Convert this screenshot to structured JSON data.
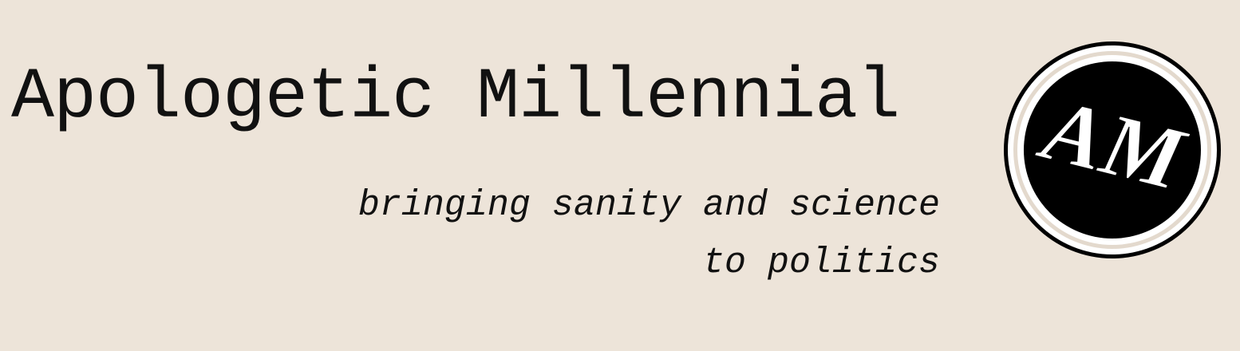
{
  "header": {
    "title": "Apologetic Millennial",
    "tagline_line1": "bringing sanity and science",
    "tagline_line2": "to politics"
  },
  "logo": {
    "letters": "AM",
    "icon": "am-monogram-icon"
  },
  "colors": {
    "background": "#ede4d9",
    "text": "#111111",
    "logo_fill": "#000000",
    "logo_letters": "#ffffff"
  }
}
